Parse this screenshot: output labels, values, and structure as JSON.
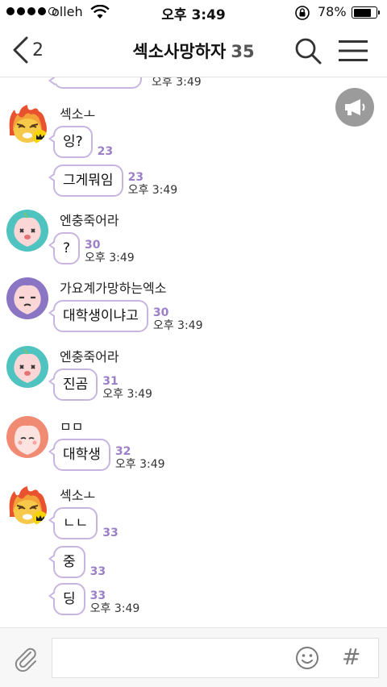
{
  "status_bar": {
    "carrier": "olleh",
    "time": "오후 3:49",
    "battery": "78%",
    "battery_level": 0.78,
    "signal_bars": 4,
    "icons": [
      "wifi-icon",
      "orientation-lock-icon",
      "battery-icon"
    ]
  },
  "header": {
    "back_count": "2",
    "title": "섹소사망하자",
    "member_count": "35",
    "icons": [
      "back-chevron-icon",
      "search-icon",
      "menu-icon"
    ]
  },
  "partial_message": {
    "time": "오후 3:49"
  },
  "groups": [
    {
      "sender": "섹소ㅗ",
      "avatar": "lion-character-with-flames",
      "messages": [
        {
          "text": "잉?",
          "unread": "23",
          "time": ""
        },
        {
          "text": "그게뭐임",
          "unread": "23",
          "time": "오후 3:49"
        }
      ]
    },
    {
      "sender": "엔충죽어라",
      "avatar": "peach-character-teal",
      "messages": [
        {
          "text": "?",
          "unread": "30",
          "time": "오후 3:49"
        }
      ]
    },
    {
      "sender": "가요계가망하는엑소",
      "avatar": "peach-character-purple",
      "messages": [
        {
          "text": "대학생이냐고",
          "unread": "30",
          "time": "오후 3:49"
        }
      ]
    },
    {
      "sender": "엔충죽어라",
      "avatar": "peach-character-teal",
      "messages": [
        {
          "text": "진곰",
          "unread": "31",
          "time": "오후 3:49"
        }
      ]
    },
    {
      "sender": "ㅁㅁ",
      "avatar": "peach-character-salmon",
      "messages": [
        {
          "text": "대학생",
          "unread": "32",
          "time": "오후 3:49"
        }
      ]
    },
    {
      "sender": "섹소ㅗ",
      "avatar": "lion-character-with-flames",
      "messages": [
        {
          "text": "ㄴㄴ",
          "unread": "33",
          "time": ""
        },
        {
          "text": "중",
          "unread": "33",
          "time": ""
        },
        {
          "text": "딩",
          "unread": "33",
          "time": "오후 3:49"
        }
      ]
    }
  ],
  "input_bar": {
    "placeholder": "",
    "hash_symbol": "#",
    "icons": [
      "attach-clip-icon",
      "emoji-icon",
      "hashtag-icon"
    ]
  },
  "colors": {
    "bubble_border": "#c7b5e0",
    "unread": "#9b7fc7",
    "notice_button": "#9b9b9b"
  }
}
